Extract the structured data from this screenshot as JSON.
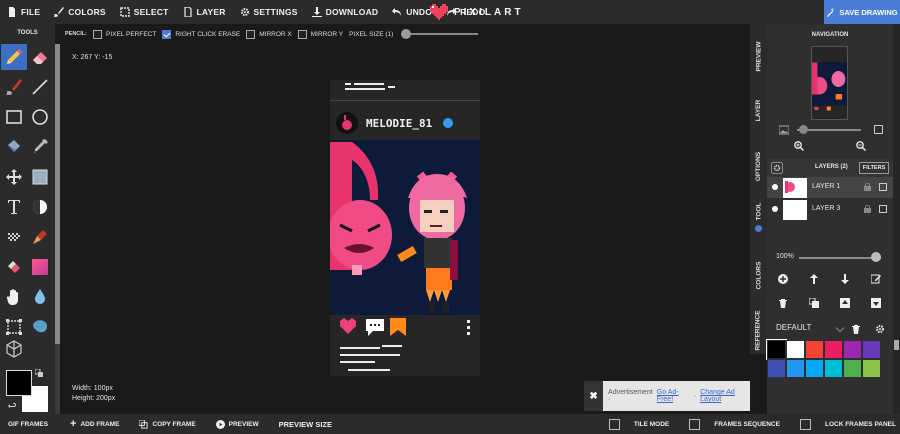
{
  "topbar": {
    "menu": [
      {
        "name": "file",
        "icon": "file-icon",
        "label": "FILE"
      },
      {
        "name": "colors",
        "icon": "brush-icon",
        "label": "COLORS"
      },
      {
        "name": "select",
        "icon": "select-icon",
        "label": "SELECT"
      },
      {
        "name": "layer",
        "icon": "layer-icon",
        "label": "LAYER"
      },
      {
        "name": "settings",
        "icon": "gear-icon",
        "label": "SETTINGS"
      },
      {
        "name": "download",
        "icon": "download-icon",
        "label": "DOWNLOAD"
      },
      {
        "name": "undo",
        "icon": "undo-icon",
        "label": "UNDO"
      },
      {
        "name": "redo",
        "icon": "redo-icon",
        "label": "REDO"
      }
    ],
    "brand": "PIXILART",
    "save_label": "SAVE DRAWING"
  },
  "options": {
    "tool_label": "PENCIL:",
    "pixel_perfect": {
      "label": "PIXEL PERFECT",
      "checked": false
    },
    "right_click_erase": {
      "label": "RIGHT CLICK ERASE",
      "checked": true
    },
    "mirror_x": {
      "label": "MIRROR X",
      "checked": false
    },
    "mirror_y": {
      "label": "MIRROR Y",
      "checked": false
    },
    "pixel_size_label": "PIXEL SIZE (1)",
    "pixel_size": 1
  },
  "toolbar": {
    "title": "TOOLS",
    "tools": [
      "pencil",
      "eraser",
      "brush",
      "line",
      "rectangle",
      "ellipse",
      "fill-bucket",
      "eyedropper",
      "move",
      "select-rectangle",
      "text",
      "shading",
      "dither",
      "stamp",
      "gradient",
      "color-swatch",
      "pan",
      "blur",
      "crop",
      "lasso",
      "cube-3d"
    ],
    "active_tool": "pencil",
    "primary_color": "#000000",
    "secondary_color": "#ffffff"
  },
  "canvas": {
    "coords": "X: 267 Y: -15",
    "width_label": "Width: 100px",
    "height_label": "Height: 200px",
    "username": "MELODIE_81"
  },
  "ad": {
    "close": "✖",
    "label": "Advertisement ·",
    "link1": "Go Ad-Free!",
    "sep": "·",
    "link2": "Change Ad Layout"
  },
  "bottombar": {
    "gif_frames": "GIF FRAMES",
    "add_frame": "ADD FRAME",
    "copy_frame": "COPY FRAME",
    "preview": "PREVIEW",
    "preview_size": "PREVIEW SIZE",
    "tile_mode": "TILE MODE",
    "frames_sequence": "FRAMES SEQUENCE",
    "lock_frames_panel": "LOCK FRAMES PANEL"
  },
  "sidetabs": [
    "PREVIEW",
    "LAYER",
    "OPTIONS",
    "TOOL",
    "COLORS",
    "REFERENCE"
  ],
  "panel": {
    "navigation_title": "NAVIGATION",
    "layers_title": "LAYERS (2)",
    "filters_label": "FILTERS",
    "layers": [
      {
        "name": "LAYER 1",
        "selected": true
      },
      {
        "name": "LAYER 3",
        "selected": false
      }
    ],
    "opacity_label": "100%",
    "opacity": 1.0,
    "palette_name": "DEFAULT",
    "palette_colors": [
      "#000000",
      "#ffffff",
      "#f44336",
      "#e91e63",
      "#9c27b0",
      "#673ab7",
      "#3f51b5",
      "#2196f3",
      "#03a9f4",
      "#00bcd4",
      "#4caf50",
      "#8bc34a"
    ]
  }
}
